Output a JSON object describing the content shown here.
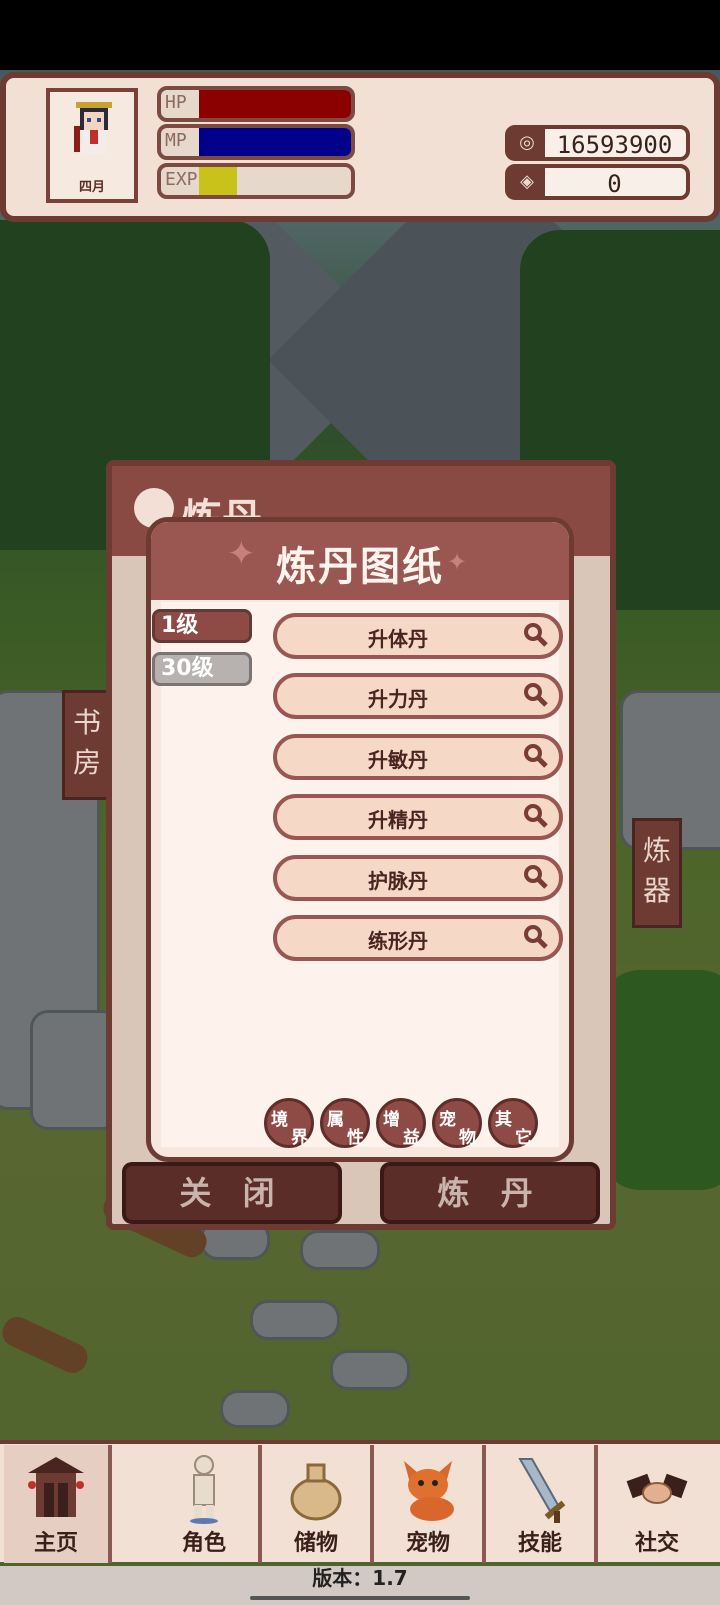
{
  "player": {
    "name": "四月",
    "hp_label": "HP",
    "mp_label": "MP",
    "exp_label": "EXP",
    "hp_fraction": 1.0,
    "mp_fraction": 1.0,
    "exp_fraction": 0.25
  },
  "currency": {
    "coins": "16593900",
    "coin_icon": "coin-icon",
    "gems": "0",
    "gem_icon": "crystal-icon"
  },
  "back_panel": {
    "title": "炼丹",
    "close_label": "关 闭",
    "refine_label": "炼 丹"
  },
  "side_signs": {
    "left": "书\n房",
    "right": "炼\n器"
  },
  "dialog": {
    "title": "炼丹图纸",
    "level_tabs": [
      {
        "label": "1级",
        "active": true
      },
      {
        "label": "30级",
        "active": false
      }
    ],
    "recipes": [
      "升体丹",
      "升力丹",
      "升敏丹",
      "升精丹",
      "护脉丹",
      "练形丹"
    ],
    "categories": [
      {
        "a": "境",
        "b": "界"
      },
      {
        "a": "属",
        "b": "性"
      },
      {
        "a": "增",
        "b": "益"
      },
      {
        "a": "宠",
        "b": "物"
      },
      {
        "a": "其",
        "b": "它"
      }
    ]
  },
  "nav": {
    "items": [
      {
        "label": "主页",
        "icon": "gate-icon",
        "active": true
      },
      {
        "label": "角色",
        "icon": "character-icon",
        "active": false
      },
      {
        "label": "储物",
        "icon": "bag-icon",
        "active": false
      },
      {
        "label": "宠物",
        "icon": "fox-icon",
        "active": false
      },
      {
        "label": "技能",
        "icon": "sword-icon",
        "active": false
      },
      {
        "label": "社交",
        "icon": "handshake-icon",
        "active": false
      }
    ]
  },
  "version_text": "版本：1.7",
  "colors": {
    "hp": "#8b0000",
    "mp": "#00008b",
    "exp": "#c8c21a",
    "accent": "#9a5752",
    "frame": "#6e3b32"
  }
}
